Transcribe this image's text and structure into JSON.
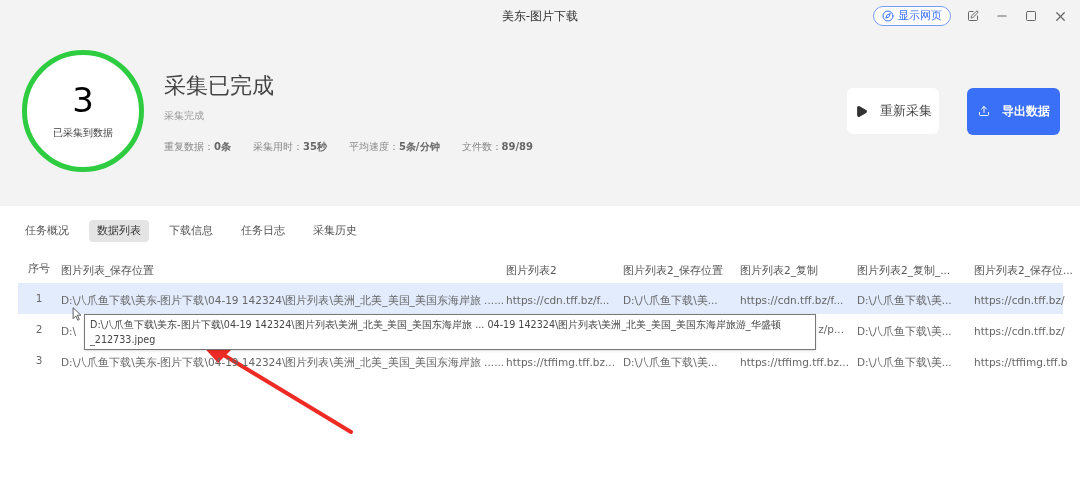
{
  "window": {
    "title": "美东-图片下载",
    "show_page_button": "显示网页"
  },
  "summary": {
    "count": "3",
    "count_label": "已采集到数据",
    "status_title": "采集已完成",
    "status_sub": "采集完成",
    "stats": [
      {
        "label": "重复数据：",
        "value": "0条"
      },
      {
        "label": "采集用时：",
        "value": "35秒"
      },
      {
        "label": "平均速度：",
        "value": "5条/分钟"
      },
      {
        "label": "文件数：",
        "value": "89/89"
      }
    ]
  },
  "actions": {
    "restart": "重新采集",
    "export": "导出数据"
  },
  "tabs": [
    {
      "label": "任务概况",
      "selected": false
    },
    {
      "label": "数据列表",
      "selected": true
    },
    {
      "label": "下载信息",
      "selected": false
    },
    {
      "label": "任务日志",
      "selected": false
    },
    {
      "label": "采集历史",
      "selected": false
    }
  ],
  "table": {
    "columns": [
      "序号",
      "图片列表_保存位置",
      "图片列表2",
      "图片列表2_保存位置",
      "图片列表2_复制",
      "图片列表2_复制_...",
      "图片列表2_保存位..."
    ],
    "rows": [
      {
        "selected": true,
        "cells": [
          "1",
          "D:\\八爪鱼下载\\美东-图片下载\\04-19 142324\\图片列表\\美洲_北美_美国_美国东海岸旅 ......",
          "https://cdn.tff.bz/f...",
          "D:\\八爪鱼下载\\美...",
          "https://cdn.tff.bz/f...",
          "D:\\八爪鱼下载\\美...",
          "https://cdn.tff.bz/"
        ]
      },
      {
        "selected": false,
        "cells": [
          "2",
          "D:\\",
          "",
          "",
          "z/p...",
          "D:\\八爪鱼下载\\美...",
          "https://cdn.tff.bz/"
        ]
      },
      {
        "selected": false,
        "cells": [
          "3",
          "D:\\八爪鱼下载\\美东-图片下载\\04-19 142324\\图片列表\\美洲_北美_美国_美国东海岸旅 ......",
          "https://tffimg.tff.bz...",
          "D:\\八爪鱼下载\\美...",
          "https://tffimg.tff.bz...",
          "D:\\八爪鱼下载\\美...",
          "https://tffimg.tff.b"
        ]
      }
    ]
  },
  "tooltip": "D:\\八爪鱼下载\\美东-图片下载\\04-19 142324\\图片列表\\美洲_北美_美国_美国东海岸旅 ... 04-19 142324\\图片列表\\美洲_北美_美国_美国东海岸旅游_华盛顿_212733.jpeg"
}
